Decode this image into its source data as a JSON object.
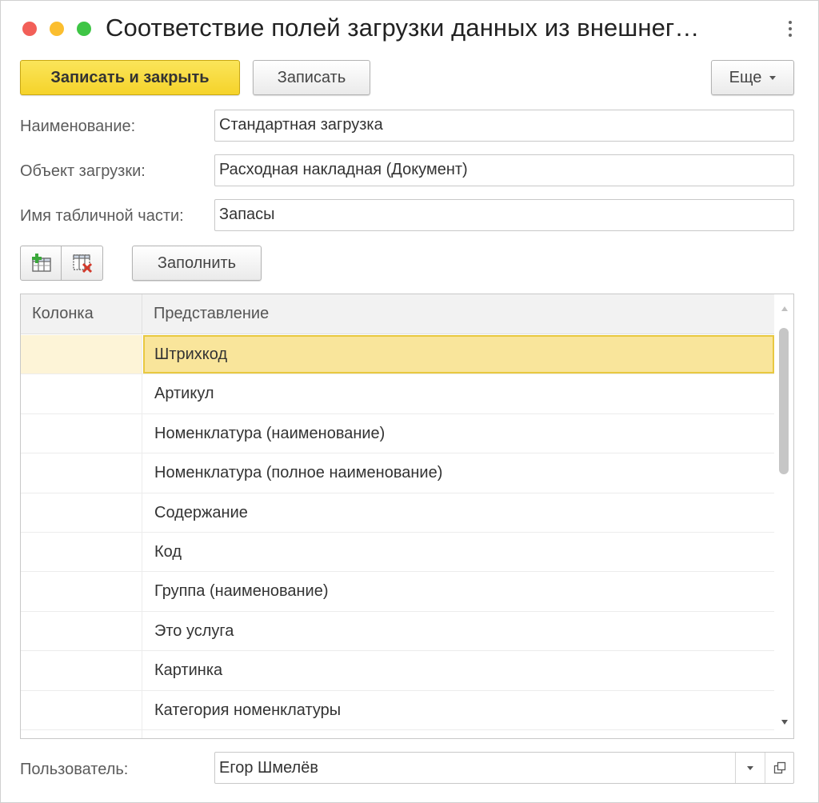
{
  "window": {
    "title": "Соответствие полей загрузки данных из внешнег…"
  },
  "toolbar": {
    "save_close_label": "Записать и закрыть",
    "save_label": "Записать",
    "more_label": "Еще"
  },
  "form": {
    "name_label": "Наименование:",
    "name_value": "Стандартная загрузка",
    "object_label": "Объект загрузки:",
    "object_value": "Расходная накладная (Документ)",
    "tabular_label": "Имя табличной части:",
    "tabular_value": "Запасы"
  },
  "table_toolbar": {
    "add_icon": "add-column-icon",
    "delete_icon": "delete-column-icon",
    "fill_label": "Заполнить"
  },
  "table": {
    "columns": [
      "Колонка",
      "Представление"
    ],
    "rows": [
      {
        "column": "",
        "representation": "Штрихкод"
      },
      {
        "column": "",
        "representation": "Артикул"
      },
      {
        "column": "",
        "representation": "Номенклатура (наименование)"
      },
      {
        "column": "",
        "representation": "Номенклатура (полное наименование)"
      },
      {
        "column": "",
        "representation": "Содержание"
      },
      {
        "column": "",
        "representation": "Код"
      },
      {
        "column": "",
        "representation": "Группа (наименование)"
      },
      {
        "column": "",
        "representation": "Это услуга"
      },
      {
        "column": "",
        "representation": "Картинка"
      },
      {
        "column": "",
        "representation": "Категория номенклатуры"
      },
      {
        "column": "",
        "representation": ""
      }
    ],
    "selected_index": 0
  },
  "footer": {
    "user_label": "Пользователь:",
    "user_value": "Егор Шмелёв"
  },
  "colors": {
    "primary_button": "#f5d32a",
    "selected_row": "#f9e59b",
    "close_dot": "#f25f58",
    "minimize_dot": "#fbbe2f",
    "maximize_dot": "#3ec545"
  }
}
